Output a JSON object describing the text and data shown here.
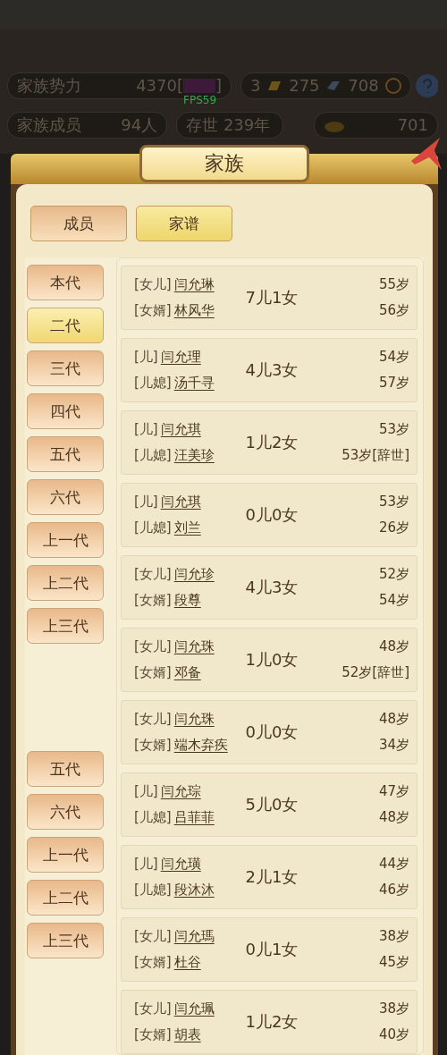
{
  "hud": {
    "power_label": "家族势力",
    "power_value": "4370[",
    "power_close": "]",
    "gold": "3",
    "scrolls": "275",
    "jade": "708",
    "members_label": "家族成员",
    "members_value": "94人",
    "age_text": "存世 239年",
    "ingots": "701",
    "fps": "FPS59"
  },
  "dialog": {
    "title": "家族"
  },
  "tabs": [
    {
      "label": "成员",
      "selected": false
    },
    {
      "label": "家谱",
      "selected": true
    }
  ],
  "generations": [
    {
      "label": "本代",
      "selected": false
    },
    {
      "label": "二代",
      "selected": true
    },
    {
      "label": "三代",
      "selected": false
    },
    {
      "label": "四代",
      "selected": false
    },
    {
      "label": "五代",
      "selected": false
    },
    {
      "label": "六代",
      "selected": false
    },
    {
      "label": "上一代",
      "selected": false
    },
    {
      "label": "上二代",
      "selected": false
    },
    {
      "label": "上三代",
      "selected": false
    }
  ],
  "generations_repeat": [
    {
      "label": "五代",
      "selected": false
    },
    {
      "label": "六代",
      "selected": false
    },
    {
      "label": "上一代",
      "selected": false
    },
    {
      "label": "上二代",
      "selected": false
    },
    {
      "label": "上三代",
      "selected": false
    }
  ],
  "couples": [
    {
      "relation_1": "[女儿]",
      "name_1": "闫允琳",
      "age_1": "55岁",
      "relation_2": "[女婿]",
      "name_2": "林风华",
      "age_2": "56岁",
      "children": "7儿1女"
    },
    {
      "relation_1": "[儿]",
      "name_1": "闫允理",
      "age_1": "54岁",
      "relation_2": "[儿媳]",
      "name_2": "汤千寻",
      "age_2": "57岁",
      "children": "4儿3女"
    },
    {
      "relation_1": "[儿]",
      "name_1": "闫允琪",
      "age_1": "53岁",
      "relation_2": "[儿媳]",
      "name_2": "汪美珍",
      "age_2": "53岁[辞世]",
      "children": "1儿2女"
    },
    {
      "relation_1": "[儿]",
      "name_1": "闫允琪",
      "age_1": "53岁",
      "relation_2": "[儿媳]",
      "name_2": "刘兰",
      "age_2": "26岁",
      "children": "0儿0女"
    },
    {
      "relation_1": "[女儿]",
      "name_1": "闫允珍",
      "age_1": "52岁",
      "relation_2": "[女婿]",
      "name_2": "段尊",
      "age_2": "54岁",
      "children": "4儿3女"
    },
    {
      "relation_1": "[女儿]",
      "name_1": "闫允珠",
      "age_1": "48岁",
      "relation_2": "[女婿]",
      "name_2": "邓备",
      "age_2": "52岁[辞世]",
      "children": "1儿0女"
    },
    {
      "relation_1": "[女儿]",
      "name_1": "闫允珠",
      "age_1": "48岁",
      "relation_2": "[女婿]",
      "name_2": "端木弃疾",
      "age_2": "34岁",
      "children": "0儿0女"
    },
    {
      "relation_1": "[儿]",
      "name_1": "闫允琮",
      "age_1": "47岁",
      "relation_2": "[儿媳]",
      "name_2": "吕菲菲",
      "age_2": "48岁",
      "children": "5儿0女"
    },
    {
      "relation_1": "[儿]",
      "name_1": "闫允璜",
      "age_1": "44岁",
      "relation_2": "[儿媳]",
      "name_2": "段沐沐",
      "age_2": "46岁",
      "children": "2儿1女"
    },
    {
      "relation_1": "[女儿]",
      "name_1": "闫允瑪",
      "age_1": "38岁",
      "relation_2": "[女婿]",
      "name_2": "杜谷",
      "age_2": "45岁",
      "children": "0儿1女"
    },
    {
      "relation_1": "[女儿]",
      "name_1": "闫允珮",
      "age_1": "38岁",
      "relation_2": "[女婿]",
      "name_2": "胡表",
      "age_2": "40岁",
      "children": "1儿2女"
    }
  ]
}
